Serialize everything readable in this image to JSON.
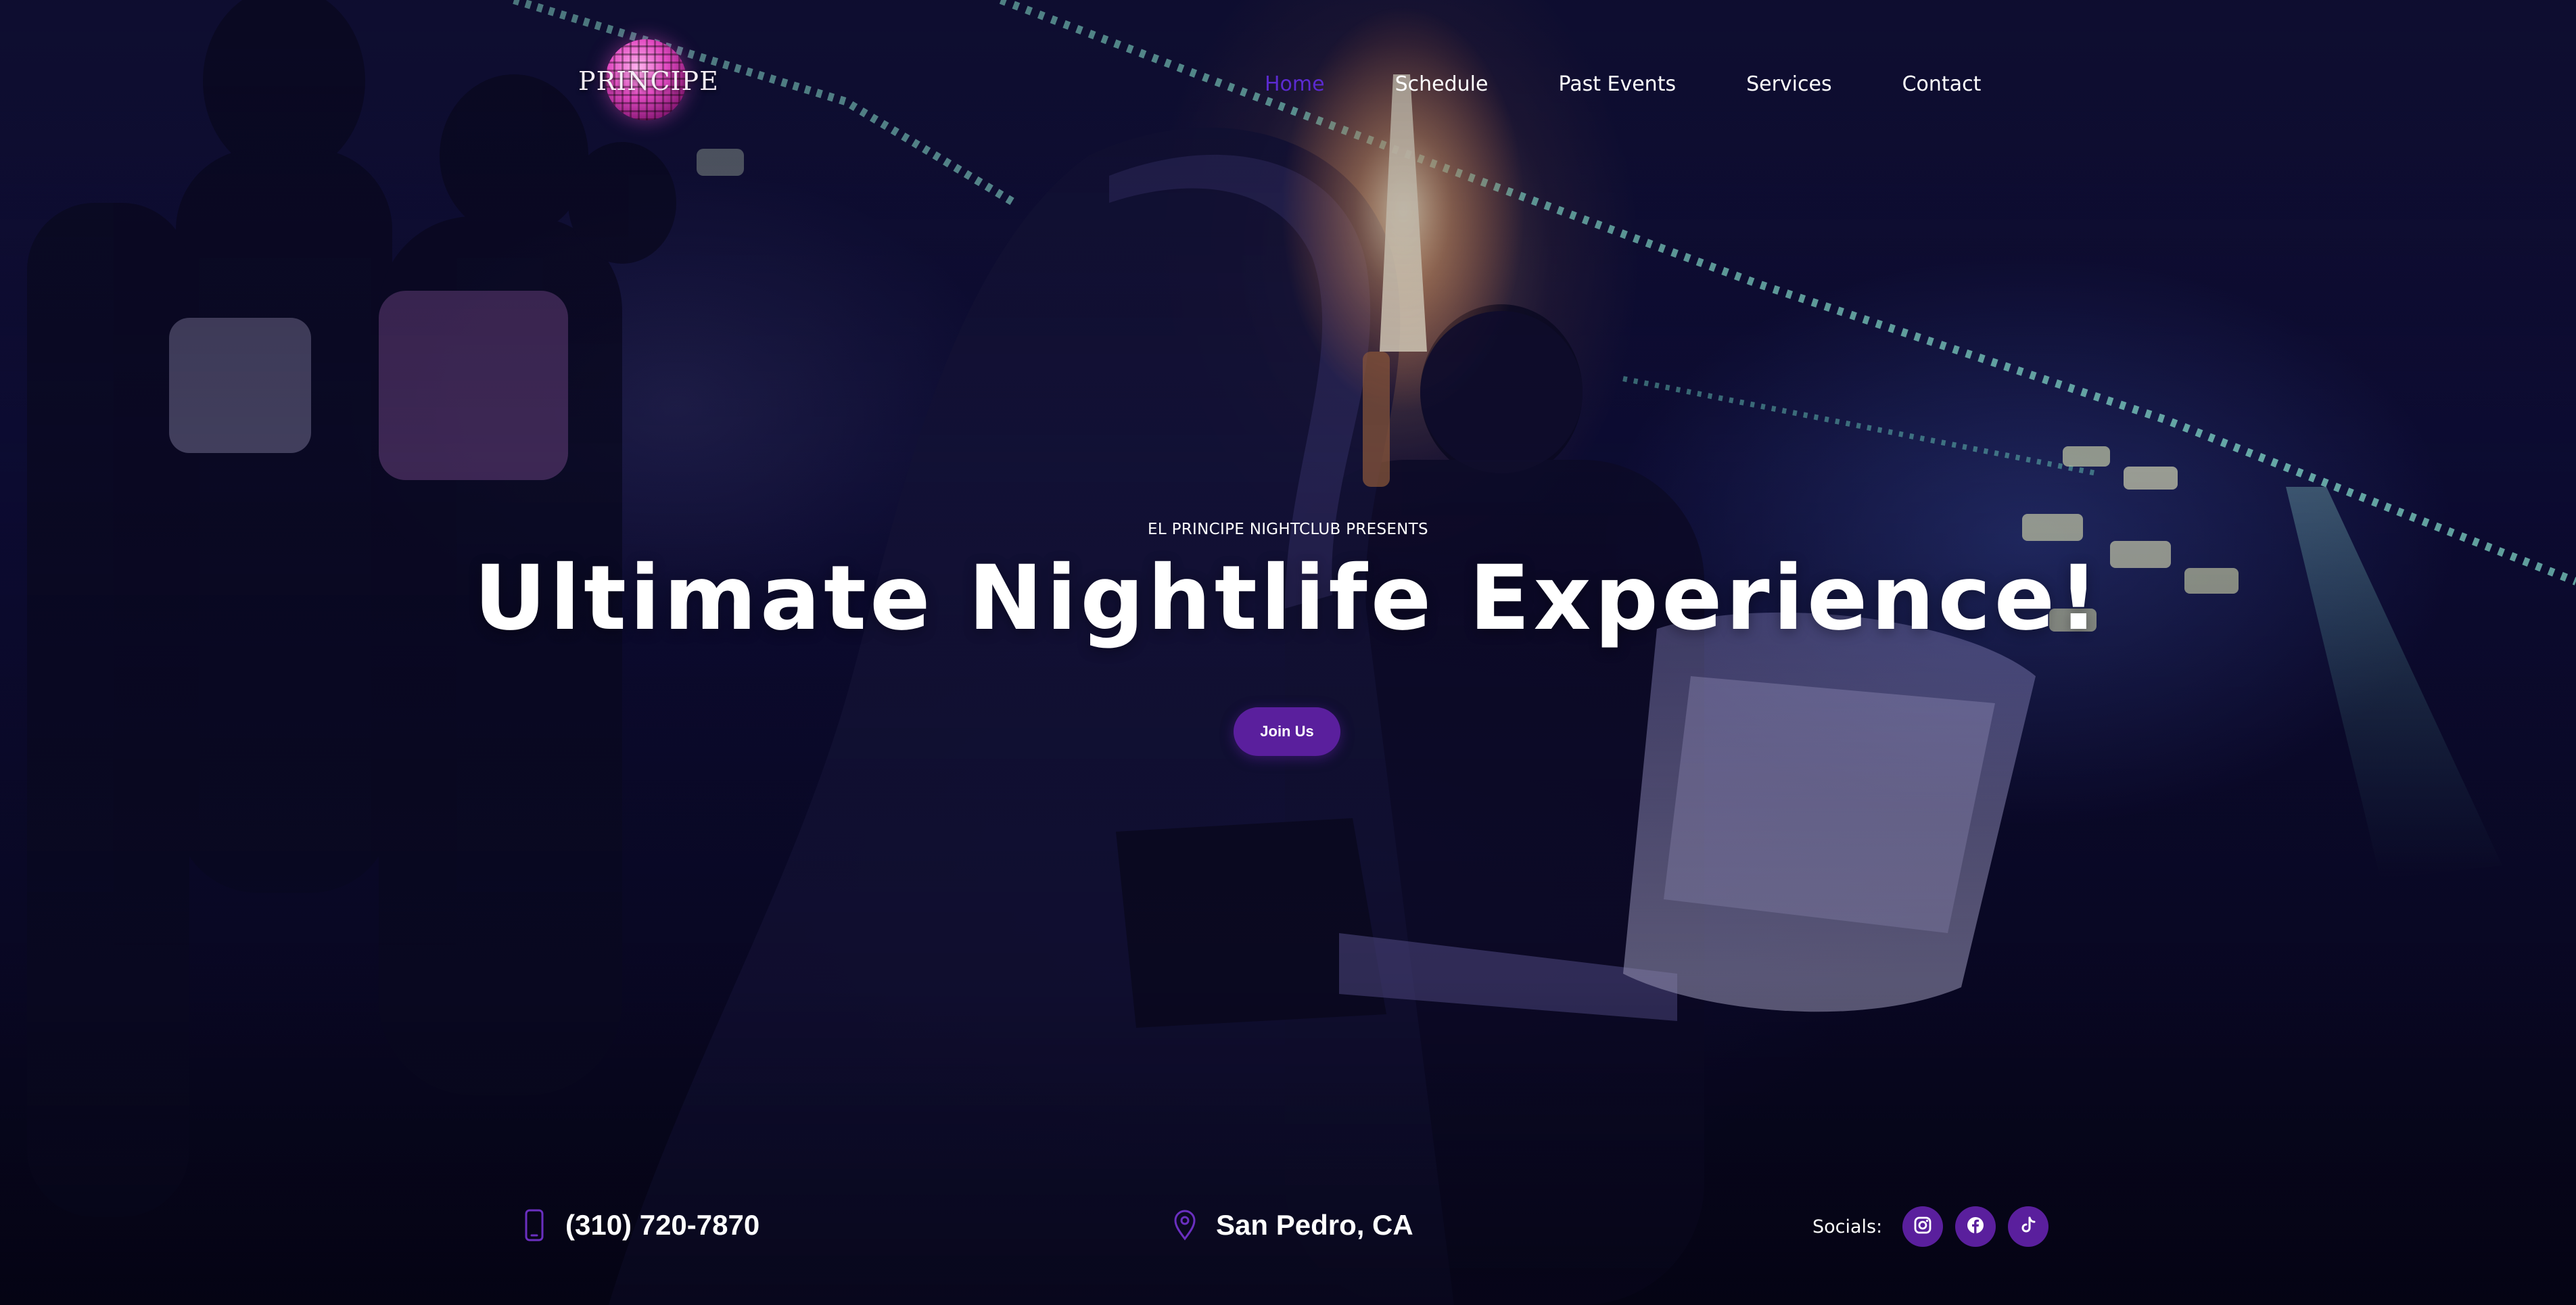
{
  "brand": {
    "logo_text": "PRINCIPE"
  },
  "nav": {
    "items": [
      {
        "label": "Home",
        "active": true
      },
      {
        "label": "Schedule",
        "active": false
      },
      {
        "label": "Past Events",
        "active": false
      },
      {
        "label": "Services",
        "active": false
      },
      {
        "label": "Contact",
        "active": false
      }
    ]
  },
  "hero": {
    "eyebrow": "EL PRINCIPE NIGHTCLUB PRESENTS",
    "headline": "Ultimate Nightlife Experience!",
    "cta_label": "Join Us"
  },
  "info": {
    "phone": {
      "icon": "phone-icon",
      "text": "(310) 720-7870"
    },
    "location": {
      "icon": "map-pin-icon",
      "text": "San Pedro, CA"
    },
    "socials": {
      "label": "Socials:",
      "items": [
        {
          "icon": "instagram-icon"
        },
        {
          "icon": "facebook-icon"
        },
        {
          "icon": "tiktok-icon"
        }
      ]
    }
  },
  "colors": {
    "accent_purple": "#5a1f9d",
    "active_nav": "#5b2ad0",
    "background_dark": "#07061c",
    "text": "#ffffff"
  }
}
